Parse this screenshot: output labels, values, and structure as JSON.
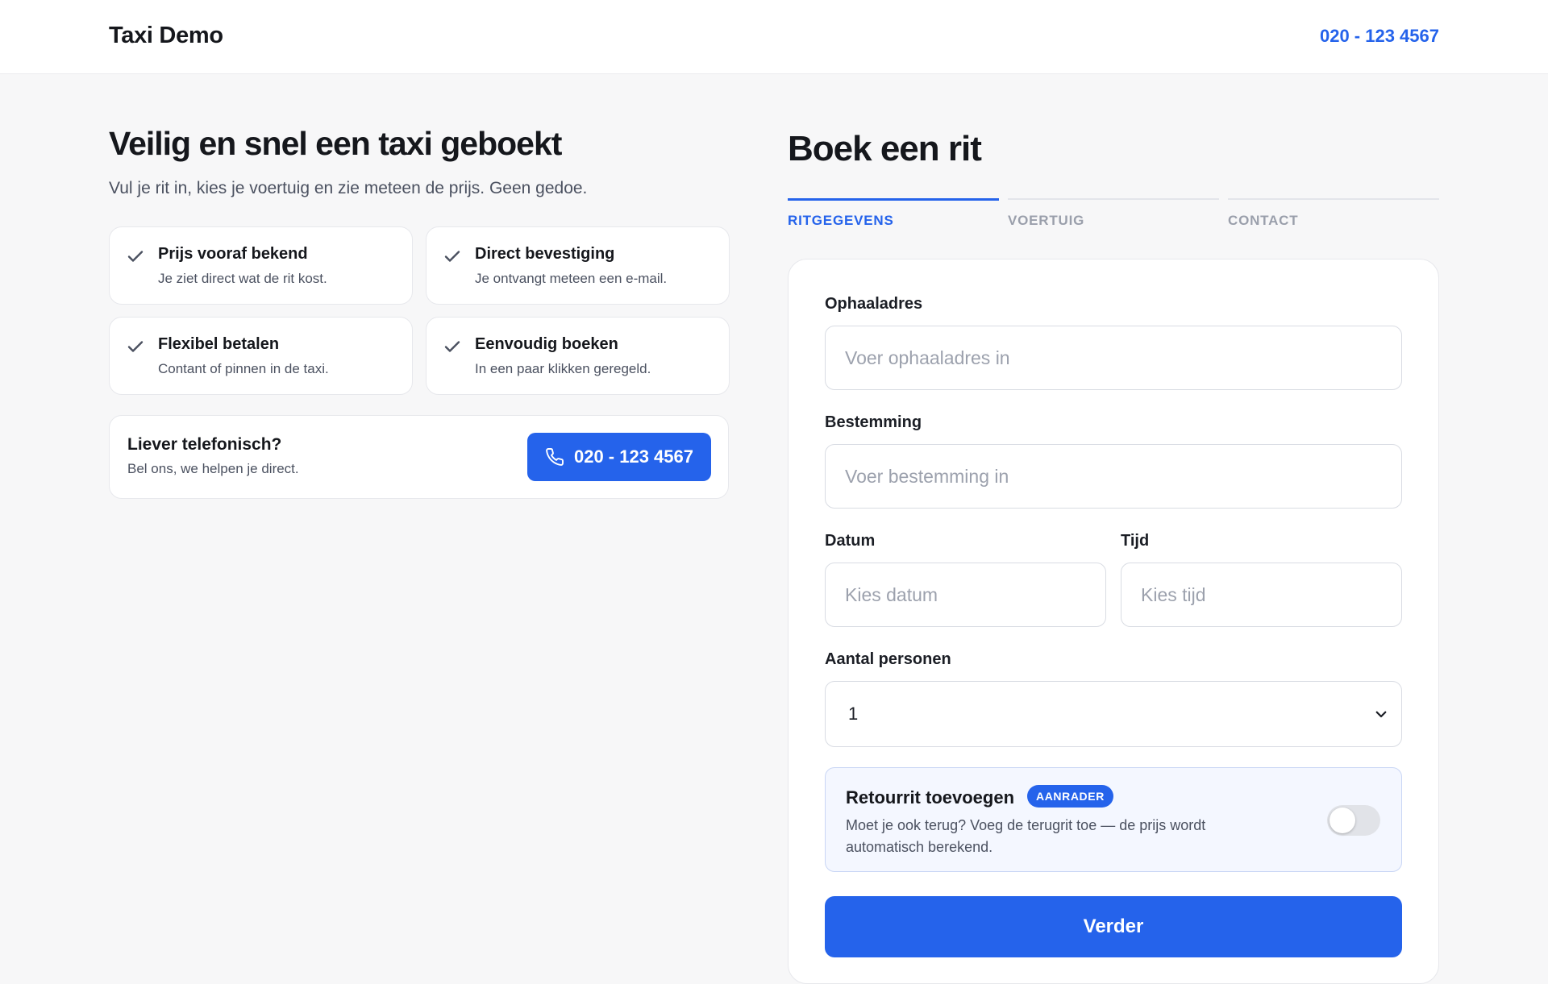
{
  "header": {
    "brand": "Taxi Demo",
    "phone": "020 - 123 4567"
  },
  "hero": {
    "title": "Veilig en snel een taxi geboekt",
    "subtitle": "Vul je rit in, kies je voertuig en zie meteen de prijs. Geen gedoe."
  },
  "features": [
    {
      "title": "Prijs vooraf bekend",
      "desc": "Je ziet direct wat de rit kost.",
      "icon": "check-icon"
    },
    {
      "title": "Direct bevestiging",
      "desc": "Je ontvangt meteen een e-mail.",
      "icon": "check-icon"
    },
    {
      "title": "Flexibel betalen",
      "desc": "Contant of pinnen in de taxi.",
      "icon": "check-icon"
    },
    {
      "title": "Eenvoudig boeken",
      "desc": "In een paar klikken geregeld.",
      "icon": "check-icon"
    }
  ],
  "call": {
    "title": "Liever telefonisch?",
    "desc": "Bel ons, we helpen je direct.",
    "button": "020 - 123 4567",
    "icon": "phone-icon"
  },
  "form": {
    "title": "Boek een rit",
    "steps": [
      "RITGEGEVENS",
      "VOERTUIG",
      "CONTACT"
    ],
    "active_step": "RITGEGEVENS",
    "pickup": {
      "label": "Ophaaladres",
      "placeholder": "Voer ophaaladres in",
      "value": ""
    },
    "destination": {
      "label": "Bestemming",
      "placeholder": "Voer bestemming in",
      "value": ""
    },
    "date": {
      "label": "Datum",
      "placeholder": "Kies datum",
      "value": ""
    },
    "time": {
      "label": "Tijd",
      "placeholder": "Kies tijd",
      "value": ""
    },
    "persons": {
      "label": "Aantal personen",
      "value": "1",
      "icon": "chevron-down-icon"
    },
    "return_trip": {
      "title": "Retourrit toevoegen",
      "badge": "AANRADER",
      "desc": "Moet je ook terug? Voeg de terugrit toe — de prijs wordt automatisch berekend.",
      "enabled": false
    },
    "submit": "Verder"
  },
  "colors": {
    "accent": "#2563eb",
    "background": "#f7f7f8",
    "card": "#ffffff",
    "text": "#15171c",
    "muted": "#4b5160"
  }
}
